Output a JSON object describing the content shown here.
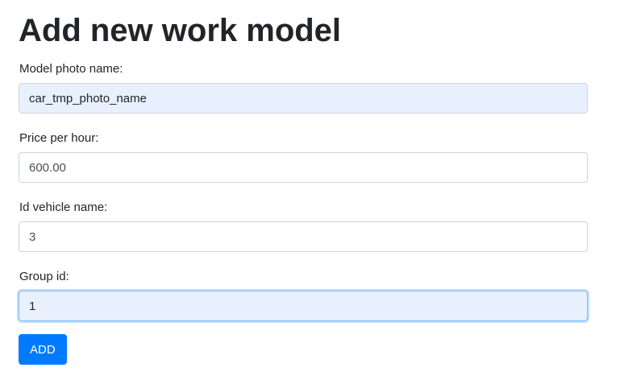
{
  "page": {
    "title": "Add new work model"
  },
  "form": {
    "model_photo_name": {
      "label": "Model photo name:",
      "value": "car_tmp_photo_name"
    },
    "price_per_hour": {
      "label": "Price per hour:",
      "value": "600.00"
    },
    "id_vehicle_name": {
      "label": "Id vehicle name:",
      "value": "3"
    },
    "group_id": {
      "label": "Group id:",
      "value": "1"
    },
    "submit_label": "ADD"
  },
  "colors": {
    "primary": "#007bff",
    "autofill_background": "#e8f0fe",
    "text": "#212529"
  }
}
